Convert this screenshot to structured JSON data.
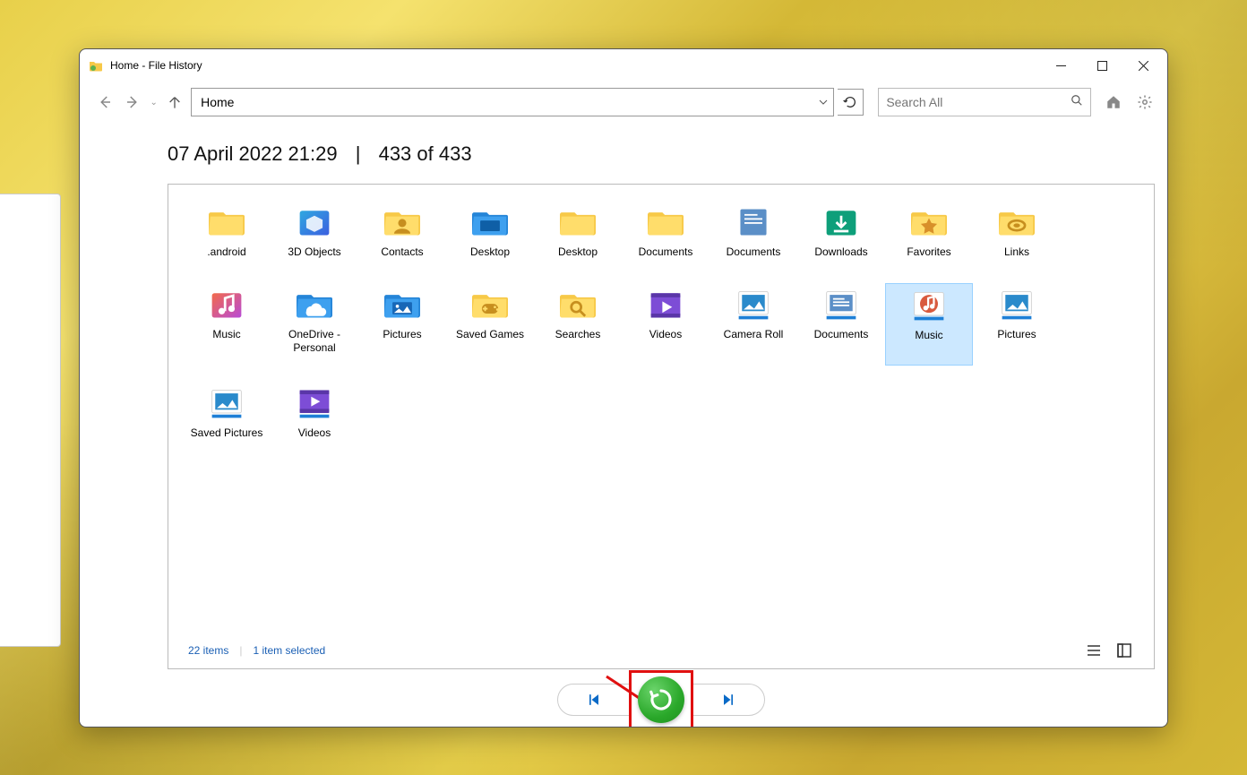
{
  "window": {
    "title": "Home - File History"
  },
  "toolbar": {
    "address": "Home",
    "search_placeholder": "Search All"
  },
  "snapshot": {
    "timestamp": "07 April 2022 21:29",
    "position": "433 of 433"
  },
  "items": [
    {
      "label": ".android",
      "icon": "folder"
    },
    {
      "label": "3D Objects",
      "icon": "3d"
    },
    {
      "label": "Contacts",
      "icon": "contacts"
    },
    {
      "label": "Desktop",
      "icon": "desktop"
    },
    {
      "label": "Desktop",
      "icon": "folder"
    },
    {
      "label": "Documents",
      "icon": "folder"
    },
    {
      "label": "Documents",
      "icon": "docs"
    },
    {
      "label": "Downloads",
      "icon": "downloads"
    },
    {
      "label": "Favorites",
      "icon": "favorites"
    },
    {
      "label": "Links",
      "icon": "links"
    },
    {
      "label": "Music",
      "icon": "music"
    },
    {
      "label": "OneDrive - Personal",
      "icon": "onedrive",
      "tall": true
    },
    {
      "label": "Pictures",
      "icon": "pictures"
    },
    {
      "label": "Saved Games",
      "icon": "games",
      "tall": true
    },
    {
      "label": "Searches",
      "icon": "searches"
    },
    {
      "label": "Videos",
      "icon": "videos"
    },
    {
      "label": "Camera Roll",
      "icon": "lib-pictures",
      "tall": true
    },
    {
      "label": "Documents",
      "icon": "lib-docs"
    },
    {
      "label": "Music",
      "icon": "lib-music",
      "selected": true
    },
    {
      "label": "Pictures",
      "icon": "lib-pictures"
    },
    {
      "label": "Saved Pictures",
      "icon": "lib-pictures",
      "tall": true
    },
    {
      "label": "Videos",
      "icon": "lib-videos"
    }
  ],
  "status": {
    "count": "22 items",
    "selection": "1 item selected"
  }
}
